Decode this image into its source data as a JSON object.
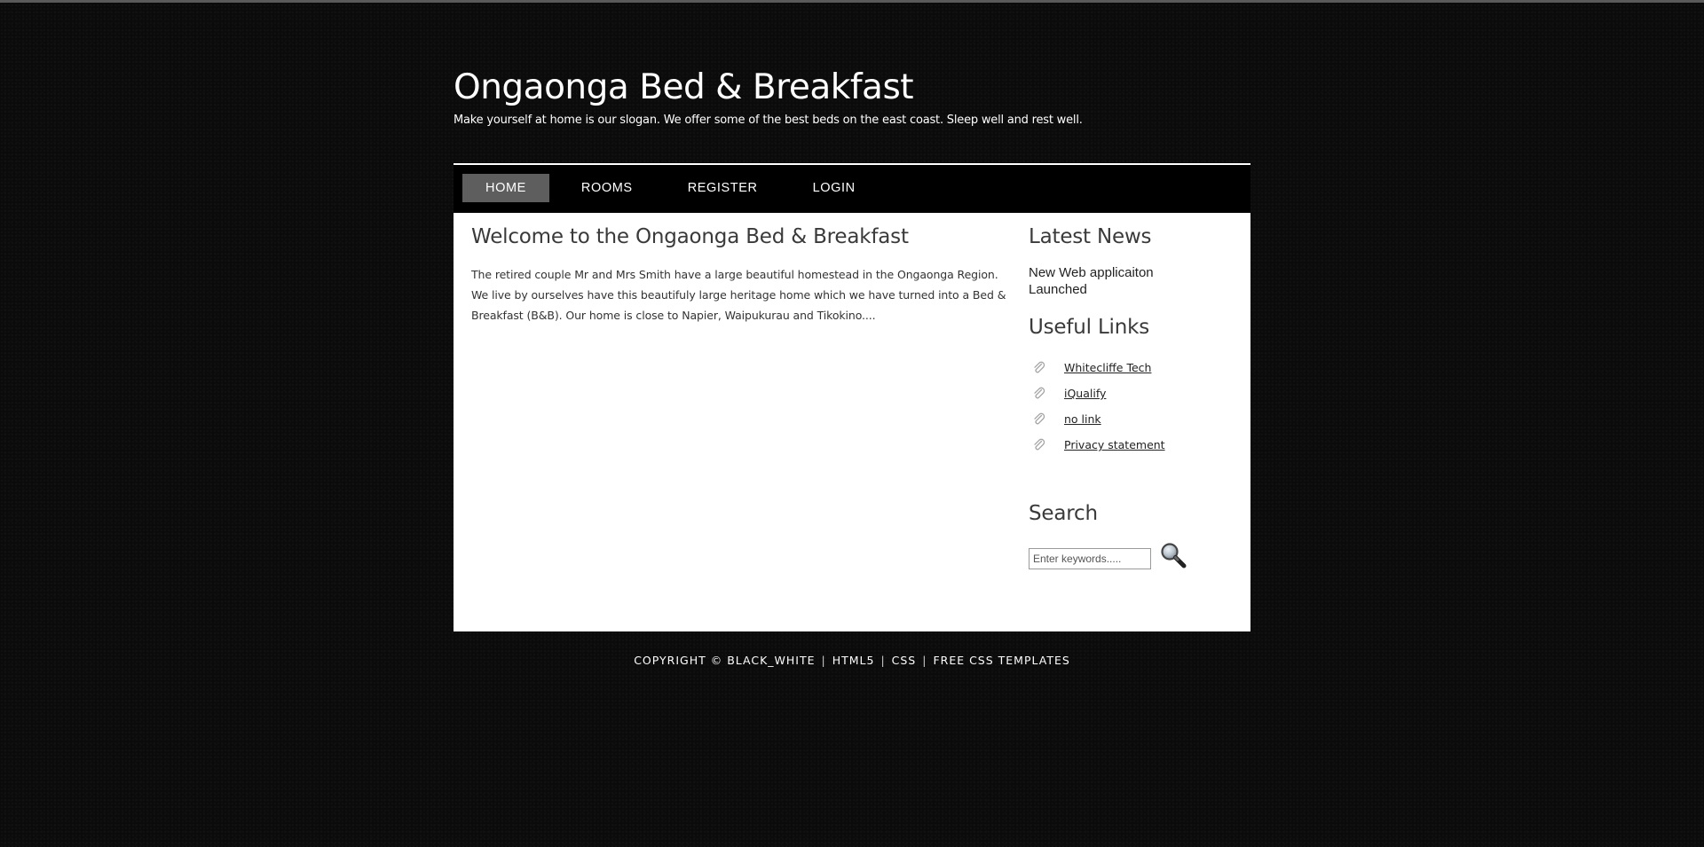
{
  "header": {
    "title": "Ongaonga Bed & Breakfast",
    "slogan": "Make yourself at home is our slogan. We offer some of the best beds on the east coast. Sleep well and rest well."
  },
  "menu": {
    "items": [
      {
        "label": "HOME",
        "current": true
      },
      {
        "label": "ROOMS",
        "current": false
      },
      {
        "label": "REGISTER",
        "current": false
      },
      {
        "label": "LOGIN",
        "current": false
      }
    ]
  },
  "main": {
    "heading": "Welcome to the Ongaonga Bed & Breakfast",
    "paragraph": "The retired couple Mr and Mrs Smith have a large beautiful homestead in the Ongaonga Region. We live by ourselves have this beautifuly large heritage home which we have turned into a Bed & Breakfast (B&B). Our home is close to Napier, Waipukurau and Tikokino...."
  },
  "sidebar": {
    "news_title": "Latest News",
    "news_item": "New Web applicaiton Launched",
    "links_title": "Useful Links",
    "links": [
      {
        "label": "Whitecliffe Tech",
        "icon": "paperclip-icon"
      },
      {
        "label": "iQualify",
        "icon": "paperclip-icon"
      },
      {
        "label": "no link",
        "icon": "paperclip-icon"
      },
      {
        "label": "Privacy statement",
        "icon": "paperclip-icon"
      }
    ],
    "search_title": "Search",
    "search_placeholder": "Enter keywords.....",
    "search_icon": "magnifier-icon"
  },
  "footer": {
    "copyright": "COPYRIGHT © BLACK_WHITE",
    "separator": "|",
    "link1": "HTML5",
    "link2": "CSS",
    "link3": "FREE CSS TEMPLATES"
  },
  "colors": {
    "background": "#0b0b0b",
    "content_bg": "#ffffff",
    "menu_current_bg": "#5e5e5e",
    "heading_text": "#3a3a3a"
  }
}
